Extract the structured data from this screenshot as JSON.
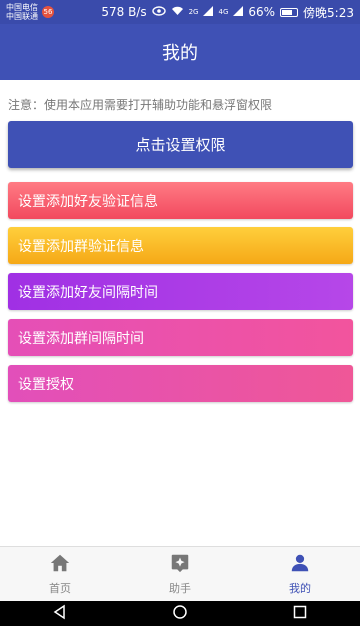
{
  "status_bar": {
    "carrier1": "中国电信",
    "carrier2": "中国联通",
    "badge": "56",
    "speed": "578 B/s",
    "network1": "2G",
    "network2": "4G",
    "battery": "66%",
    "time": "傍晚5:23"
  },
  "header": {
    "title": "我的"
  },
  "notice": "注意：使用本应用需要打开辅助功能和悬浮窗权限",
  "primary_button": "点击设置权限",
  "actions": [
    "设置添加好友验证信息",
    "设置添加群验证信息",
    "设置添加好友间隔时间",
    "设置添加群间隔时间",
    "设置授权"
  ],
  "bottom_nav": {
    "items": [
      {
        "label": "首页",
        "icon": "home-icon"
      },
      {
        "label": "助手",
        "icon": "assistant-icon"
      },
      {
        "label": "我的",
        "icon": "person-icon"
      }
    ],
    "active_index": 2
  },
  "colors": {
    "primary": "#3f51b5",
    "status_bar": "#3a4bab"
  }
}
